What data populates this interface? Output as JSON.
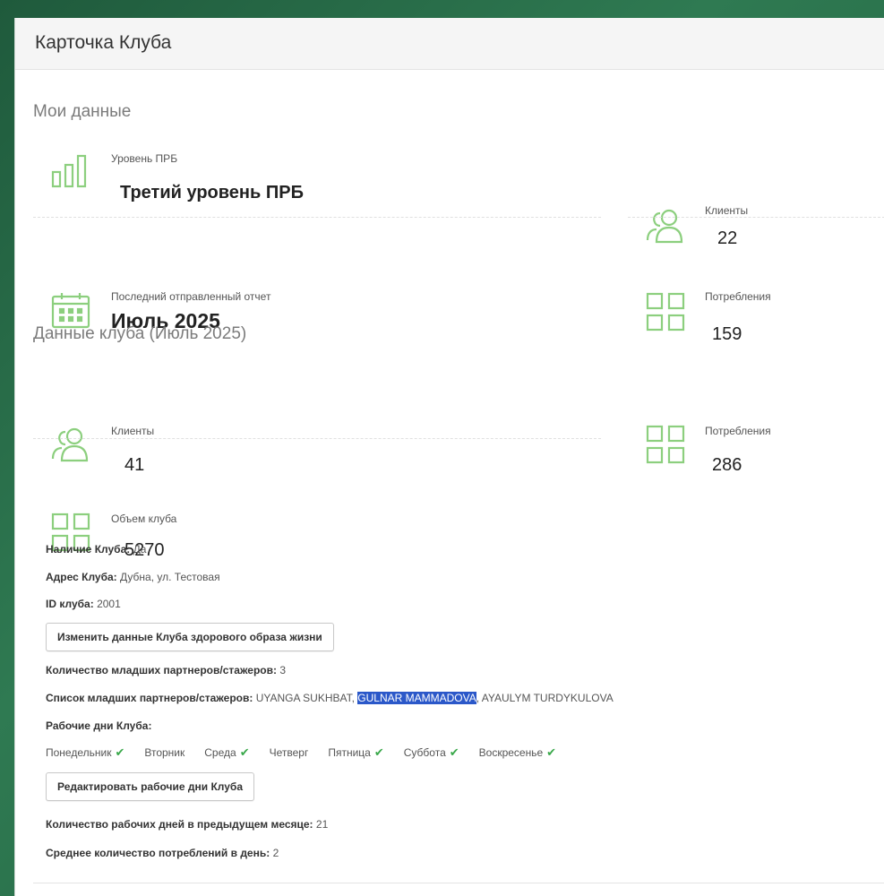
{
  "page": {
    "title": "Карточка Клуба"
  },
  "my_data": {
    "section_title": "Мои данные",
    "level": {
      "label": "Уровень ПРБ",
      "value": "Третий уровень ПРБ"
    },
    "clients": {
      "label": "Клиенты",
      "value": "22"
    },
    "last_report": {
      "label": "Последний отправленный отчет",
      "value": "Июль 2025"
    },
    "consumptions": {
      "label": "Потребления",
      "value": "159"
    }
  },
  "club_data": {
    "section_title": "Данные клуба (Июль 2025)",
    "clients": {
      "label": "Клиенты",
      "value": "41"
    },
    "consumptions": {
      "label": "Потребления",
      "value": "286"
    },
    "volume": {
      "label": "Объем клуба",
      "value": "5270"
    }
  },
  "info": {
    "club_presence": {
      "label": "Наличие Клуба:",
      "value": "Да"
    },
    "club_address": {
      "label": "Адрес Клуба:",
      "value": "Дубна, ул. Тестовая"
    },
    "club_id": {
      "label": "ID клуба:",
      "value": "2001"
    },
    "edit_club_button": "Изменить данные Клуба здорового образа жизни",
    "junior_count": {
      "label": "Количество младших партнеров/стажеров:",
      "value": "3"
    },
    "junior_list": {
      "label": "Список младших партнеров/стажеров:",
      "names": [
        "UYANGA SUKHBAT,",
        "GULNAR MAMMADOVA",
        ", AYAULYM TURDYKULOVA"
      ]
    },
    "work_days_label": "Рабочие дни Клуба:",
    "days": [
      {
        "name": "Понедельник",
        "checked": true
      },
      {
        "name": "Вторник",
        "checked": false
      },
      {
        "name": "Среда",
        "checked": true
      },
      {
        "name": "Четверг",
        "checked": false
      },
      {
        "name": "Пятница",
        "checked": true
      },
      {
        "name": "Суббота",
        "checked": true
      },
      {
        "name": "Воскресенье",
        "checked": true
      }
    ],
    "edit_days_button": "Редактировать рабочие дни Клуба",
    "prev_month_days": {
      "label": "Количество рабочих дней в предыдущем месяце:",
      "value": "21"
    },
    "avg_consumptions": {
      "label": "Среднее количество потреблений в день:",
      "value": "2"
    }
  },
  "colors": {
    "icon_green": "#8ccf7e",
    "check_green": "#39a84a",
    "highlight": "#2b58c9"
  },
  "icons": {
    "level": "bar-chart-icon",
    "clients": "users-icon",
    "report": "calendar-icon",
    "consumptions": "grid-icon"
  }
}
